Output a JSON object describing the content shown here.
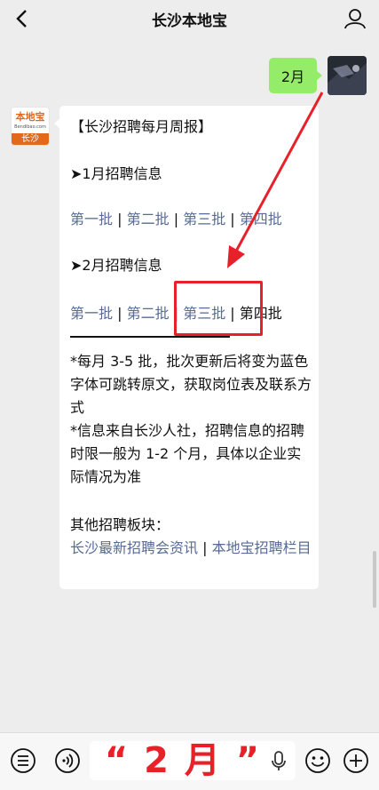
{
  "header": {
    "title": "长沙本地宝"
  },
  "user_message": {
    "text": "2月"
  },
  "bot": {
    "avatar": {
      "brand_text": "本地宝",
      "brand_url": "Bendibao.com",
      "city": "长沙"
    },
    "message": {
      "heading": "【长沙招聘每月周报】",
      "jan": {
        "label": "➤1月招聘信息",
        "batches": [
          "第一批",
          "第二批",
          "第三批",
          "第四批"
        ]
      },
      "feb": {
        "label": "➤2月招聘信息",
        "batches": [
          "第一批",
          "第二批",
          "第三批",
          "第四批"
        ]
      },
      "separator": "|",
      "note1": "*每月 3-5 批，批次更新后将变为蓝色字体可跳转原文，获取岗位表及联系方式",
      "note2": "*信息来自长沙人社，招聘信息的招聘时限一般为 1-2 个月，具体以企业实际情况为准",
      "other_label": "其他招聘板块：",
      "other_link1": "长沙最新招聘会资讯",
      "other_link2": "本地宝招聘栏目"
    }
  },
  "input": {
    "text": "“ 2 月 ”"
  },
  "colors": {
    "link": "#576b95",
    "user_bubble": "#95ec69",
    "annotation": "#e8202a",
    "brand": "#e2691a"
  },
  "icons": [
    "back-arrow-icon",
    "person-icon",
    "list-menu-icon",
    "voice-wave-icon",
    "microphone-icon",
    "emoji-icon",
    "plus-icon"
  ]
}
